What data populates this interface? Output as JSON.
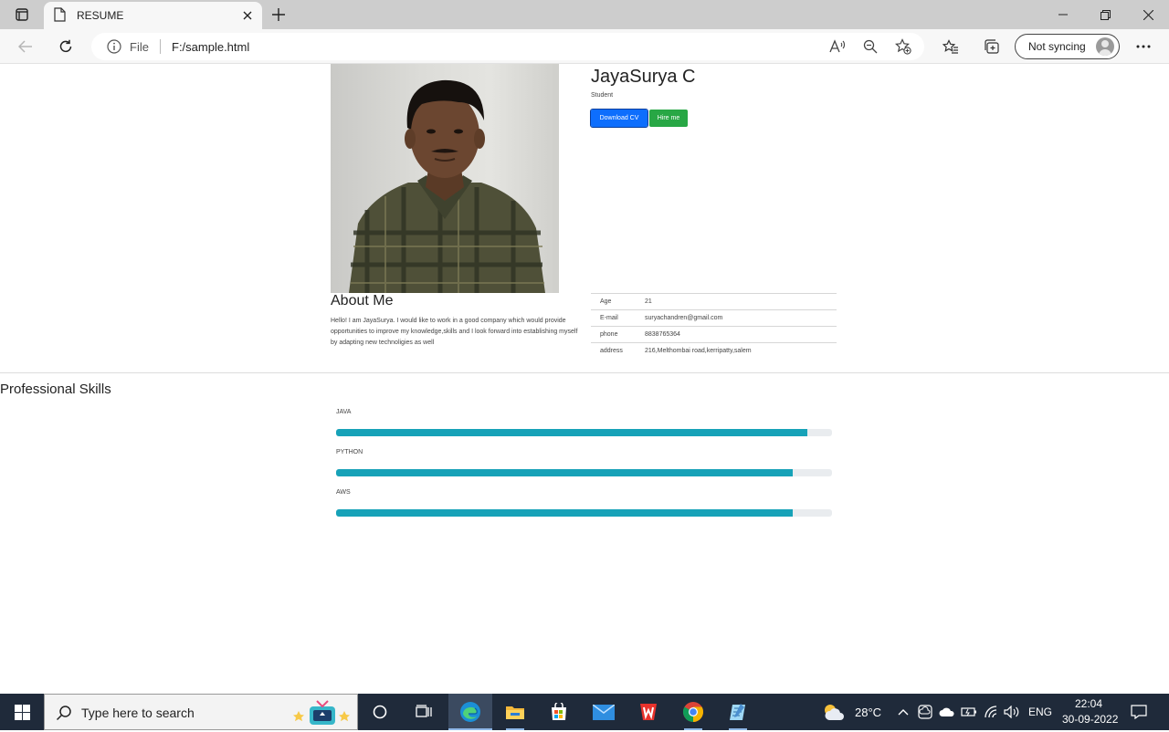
{
  "browser": {
    "tab_title": "RESUME",
    "address_prefix": "File",
    "url": "F:/sample.html",
    "sync_label": "Not syncing"
  },
  "resume": {
    "name": "JayaSurya C",
    "role": "Student",
    "download_cv": "Download CV",
    "hire_me": "Hire me",
    "about_title": "About Me",
    "about_text": "Hello! I am JayaSurya. I would like to work in a good company which would provide opportunities to improve my knowledge,skills and I look forward into establishing myself by adapting new technoligies as well",
    "info": [
      {
        "key": "Age",
        "value": "21"
      },
      {
        "key": "E-mail",
        "value": "suryachandren@gmail.com"
      },
      {
        "key": "phone",
        "value": "8838765364"
      },
      {
        "key": "address",
        "value": "216,Melthombai road,kerripatty,salem"
      }
    ],
    "skills_title": "Professional Skills",
    "skills": [
      {
        "name": "JAVA",
        "level": 0.95
      },
      {
        "name": "PYTHON",
        "level": 0.92
      },
      {
        "name": "AWS",
        "level": 0.92
      }
    ]
  },
  "taskbar": {
    "search_placeholder": "Type here to search",
    "temperature": "28°C",
    "language": "ENG",
    "time": "22:04",
    "date": "30-09-2022"
  },
  "colors": {
    "primary": "#0d6efd",
    "success": "#28a745",
    "progress": "#17a2b8",
    "taskbar": "#1f2a3a"
  }
}
